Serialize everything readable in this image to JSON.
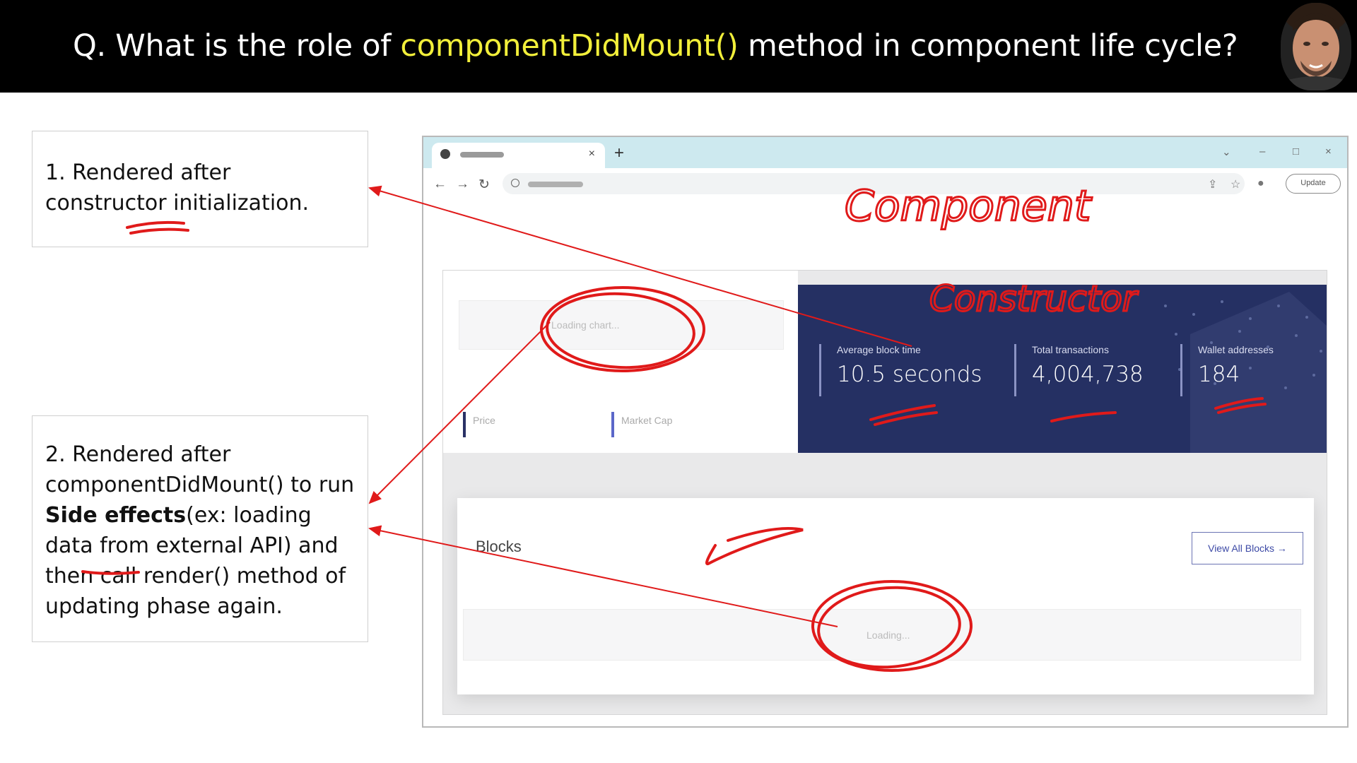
{
  "slide": {
    "question_prefix": "Q. What is the role of ",
    "question_highlight": "componentDidMount()",
    "question_suffix": " method in component life cycle?",
    "note1": "1. Rendered after constructor initialization.",
    "note2": {
      "line1": "2. Rendered after componentDidMount() to run",
      "bold": "Side effects",
      "line2": "(ex: loading data from external API) and then call render() method of updating phase again."
    }
  },
  "browser": {
    "new_tab": "+",
    "close_tab": "×",
    "minimize": "–",
    "maximize": "□",
    "close_window": "×",
    "back": "←",
    "forward": "→",
    "reload": "↻",
    "update_label": "Update"
  },
  "page": {
    "loading_chart": "Loading chart...",
    "price_label": "Price",
    "market_cap_label": "Market Cap",
    "stats": [
      {
        "label": "Average block time",
        "value": "10.5 seconds"
      },
      {
        "label": "Total transactions",
        "value": "4,004,738"
      },
      {
        "label": "Wallet addresses",
        "value": "184"
      }
    ],
    "blocks_title": "Blocks",
    "view_all": "View All Blocks →",
    "loading_blocks": "Loading..."
  },
  "annotations": {
    "component": "Component",
    "constructor": "Constructor"
  },
  "colors": {
    "highlight": "#f2ef3a",
    "ink": "#e01a1a",
    "stats_bg": "#253063"
  }
}
